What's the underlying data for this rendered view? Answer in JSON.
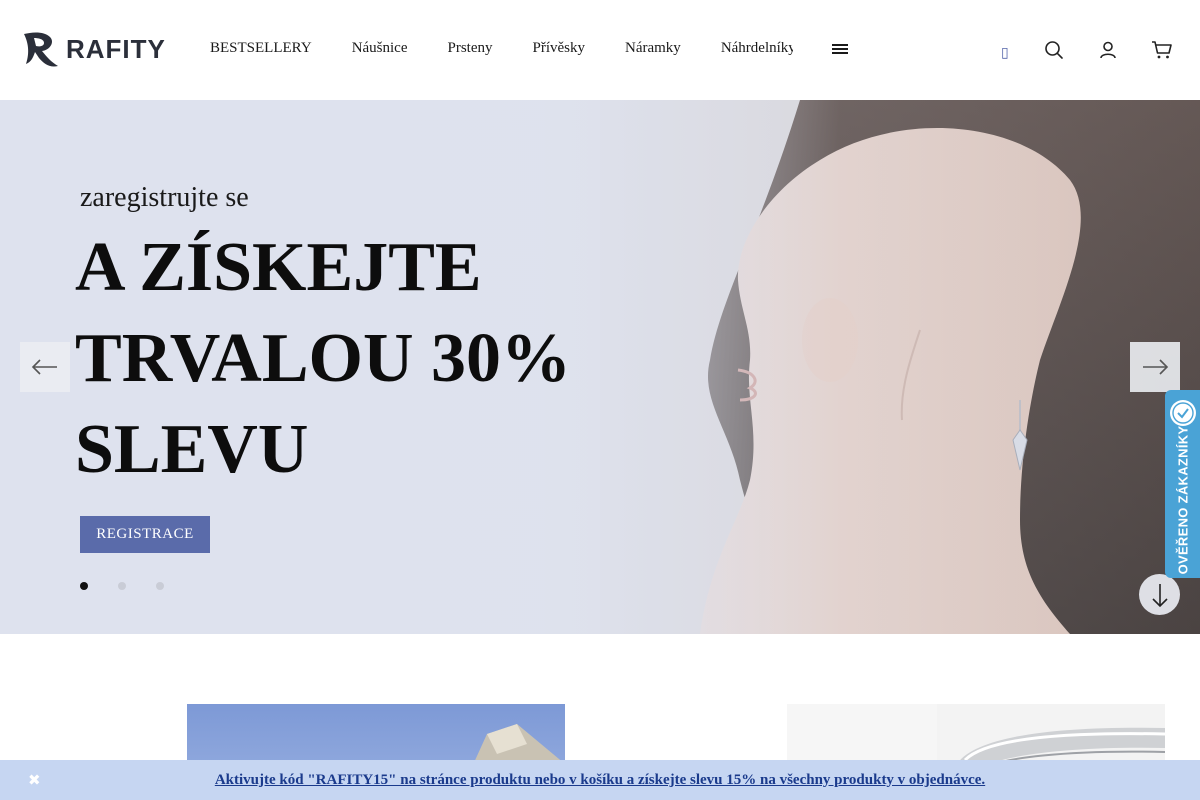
{
  "brand": {
    "name": "RAFITY",
    "logo_icon": "r-logo-icon"
  },
  "nav": {
    "items": [
      {
        "label": "BESTSELLERY"
      },
      {
        "label": "Náušnice"
      },
      {
        "label": "Prsteny"
      },
      {
        "label": "Přívěsky"
      },
      {
        "label": "Náramky"
      },
      {
        "label": "Náhrdelníky"
      }
    ],
    "more_icon": "menu-lines-icon"
  },
  "header_icons": [
    "search-icon",
    "user-icon",
    "cart-icon"
  ],
  "hero": {
    "pretitle": "zaregistrujte se",
    "title_lines": [
      "A ZÍSKEJTE",
      "TRVALOU 30%",
      "SLEVU"
    ],
    "button_label": "REGISTRACE",
    "slides_total": 3,
    "active_slide": 1
  },
  "verified_badge": {
    "label": "OVĚŘENO ZÁKAZNÍKY"
  },
  "promo_bar": {
    "text": "Aktivujte kód \"RAFITY15\" na stránce produktu nebo v košíku a získejte slevu 15% na všechny produkty v objednávce.",
    "close_symbol": "✖"
  },
  "colors": {
    "accent": "#5a6baa",
    "promo_bg": "#c6d6f2",
    "badge_bg": "#4aa3d6",
    "promo_link": "#1a3a8c"
  }
}
